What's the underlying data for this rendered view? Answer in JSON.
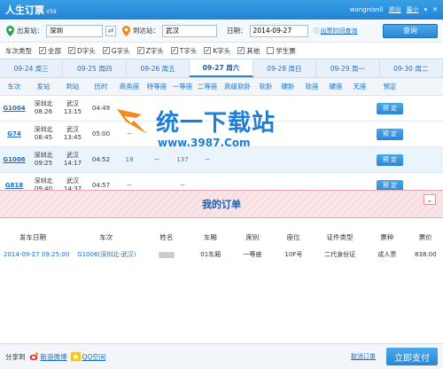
{
  "app": {
    "title": "人生订票",
    "version": "V59",
    "user": "wangnianll",
    "logout": "退出",
    "minimize": "最小",
    "more": "▾",
    "close": "✕"
  },
  "search": {
    "from_label": "出发站：",
    "from_value": "深圳",
    "to_label": "到达站：",
    "to_value": "武汉",
    "date_label": "日期：",
    "date_value": "2014-09-27",
    "schedule_link": "出票时间查询",
    "query_button": "查询"
  },
  "filters": {
    "label": "车次类型",
    "options": [
      {
        "label": "全部",
        "checked": true
      },
      {
        "label": "D字头",
        "checked": true
      },
      {
        "label": "G字头",
        "checked": true
      },
      {
        "label": "Z字头",
        "checked": true
      },
      {
        "label": "T字头",
        "checked": true
      },
      {
        "label": "K字头",
        "checked": true
      },
      {
        "label": "其他",
        "checked": true
      },
      {
        "label": "学生票",
        "checked": false
      }
    ]
  },
  "date_tabs": [
    "09-24 周三",
    "09-25 周四",
    "09-26 周五",
    "09-27 周六",
    "09-28 周日",
    "09-29 周一",
    "09-30 周二"
  ],
  "active_tab_index": 3,
  "columns": [
    "车次",
    "发站",
    "到站",
    "历时",
    "商务座",
    "特等座",
    "一等座",
    "二等座",
    "高级软卧",
    "软卧",
    "硬卧",
    "软座",
    "硬座",
    "无座",
    "预定"
  ],
  "trains": [
    {
      "no": "G1004",
      "from": "深圳北",
      "dep": "08:26",
      "to": "武汉",
      "arr": "13:15",
      "dur": "04:49",
      "shangwu": "",
      "tedeng": "",
      "yideng": "",
      "erdeng": "",
      "gaoji": "",
      "ruanwo": "",
      "yingwo": "",
      "ruanzuo": "",
      "yingzuo": "",
      "wuzuo": "",
      "book": "预 定"
    },
    {
      "no": "G74",
      "from": "深圳北",
      "dep": "08:45",
      "to": "武汉",
      "arr": "13:45",
      "dur": "05:00",
      "shangwu": "--",
      "tedeng": "",
      "yideng": "",
      "erdeng": "",
      "gaoji": "",
      "ruanwo": "",
      "yingwo": "",
      "ruanzuo": "",
      "yingzuo": "",
      "wuzuo": "",
      "book": "预 定"
    },
    {
      "no": "G1006",
      "from": "深圳北",
      "dep": "09:25",
      "to": "武汉",
      "arr": "14:17",
      "dur": "04:52",
      "shangwu": "19",
      "tedeng": "--",
      "yideng": "137",
      "erdeng": "--",
      "gaoji": "",
      "ruanwo": "",
      "yingwo": "",
      "ruanzuo": "",
      "yingzuo": "",
      "wuzuo": "",
      "book": "预 定"
    },
    {
      "no": "G818",
      "from": "深圳北",
      "dep": "09:40",
      "to": "武汉",
      "arr": "14:37",
      "dur": "04:57",
      "shangwu": "--",
      "tedeng": "",
      "yideng": "--",
      "erdeng": "",
      "gaoji": "",
      "ruanwo": "",
      "yingwo": "",
      "ruanzuo": "",
      "yingzuo": "",
      "wuzuo": "",
      "book": "预 定"
    }
  ],
  "watermark": {
    "text": "统一下载站",
    "sub": "www.3987.Com"
  },
  "orders": {
    "title": "我的订单",
    "collapse": "⌄",
    "columns": [
      "发车日期",
      "车次",
      "姓名",
      "车厢",
      "席别",
      "座位",
      "证件类型",
      "票种",
      "票价"
    ],
    "rows": [
      {
        "date": "2014-09-27 09:25:00",
        "train": "G1006(深圳北-武汉)",
        "name": "",
        "coach": "01车厢",
        "class": "一等座",
        "seat": "10F号",
        "id_type": "二代身份证",
        "ticket_type": "成人票",
        "price": "838.00"
      }
    ]
  },
  "footer": {
    "share_label": "分享到",
    "weibo": "新浪微博",
    "qzone": "QQ空间",
    "cancel": "取消订单",
    "pay": "立即支付"
  },
  "colors": {
    "primary": "#2a86d4",
    "accent_green": "#2a9a2a",
    "orders_bg": "#fbe7ea"
  }
}
